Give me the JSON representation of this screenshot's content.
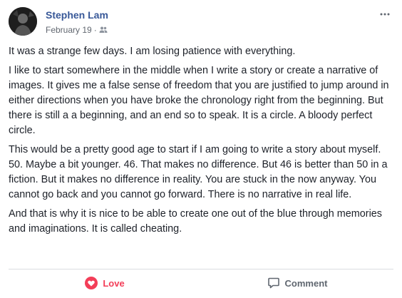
{
  "post": {
    "author": "Stephen Lam",
    "date": "February 19",
    "separator": "·",
    "privacy_icon": "friends-icon",
    "more_icon": "more-options-icon",
    "paragraphs": [
      "It was a strange few days. I am losing patience with everything.",
      "I like to start somewhere in the middle when I write a story or create a narrative of images. It gives me a false sense of freedom that you are justified to jump around in either directions when you have broke the chronology right from the beginning. But there is still a a beginning, and an end so to speak. It is a circle. A bloody perfect circle.",
      "This would be a pretty good age to start if I am going to write a story about myself. 50. Maybe a bit younger. 46. That makes no difference. But 46 is better than 50 in a fiction. But it makes no difference in reality. You are stuck in the now anyway. You cannot go back and you cannot go forward. There is no narrative in real life.",
      "And that is why it is nice to be able to create one out of the blue through memories and imaginations. It is called cheating."
    ]
  },
  "actions": {
    "love_label": "Love",
    "love_icon": "love-icon",
    "comment_label": "Comment",
    "comment_icon": "comment-icon"
  },
  "colors": {
    "author": "#385898",
    "love": "#f33e58",
    "meta": "#616770"
  }
}
